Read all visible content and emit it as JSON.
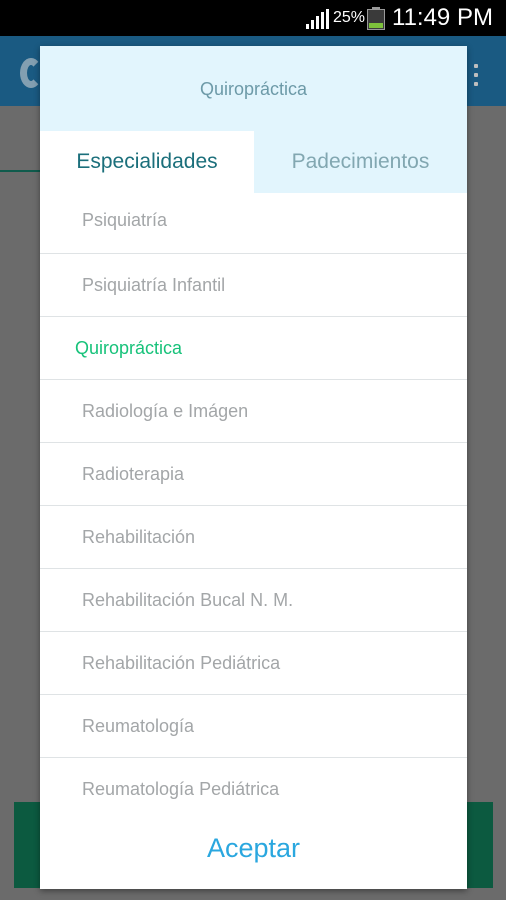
{
  "status_bar": {
    "battery_percent": "25%",
    "time": "11:49 PM"
  },
  "dialog": {
    "title": "Quiropráctica",
    "tabs": [
      {
        "label": "Especialidades",
        "active": true
      },
      {
        "label": "Padecimientos",
        "active": false
      }
    ],
    "items": [
      {
        "label": "Psiquiatría"
      },
      {
        "label": "Psiquiatría Infantil"
      },
      {
        "label": "Quiropráctica",
        "selected": true
      },
      {
        "label": "Radiología e Imágen"
      },
      {
        "label": "Radioterapia"
      },
      {
        "label": "Rehabilitación"
      },
      {
        "label": "Rehabilitación Bucal N. M."
      },
      {
        "label": "Rehabilitación Pediátrica"
      },
      {
        "label": "Reumatología"
      },
      {
        "label": "Reumatología Pediátrica"
      }
    ],
    "accept_label": "Aceptar"
  },
  "colors": {
    "selected_text": "#17c27a",
    "accept_text": "#2aa7df",
    "header_background": "#e2f5fd",
    "active_tab_text": "#1b6f7b"
  }
}
